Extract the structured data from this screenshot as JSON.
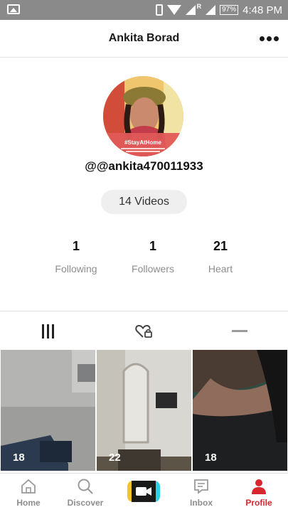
{
  "status_bar": {
    "time": "4:48 PM",
    "battery": "97%",
    "network_tag": "R"
  },
  "header": {
    "title": "Ankita Borad"
  },
  "profile": {
    "avatar_caption": "#StayAtHome",
    "username": "@@ankita470011933",
    "videos_label": "14 Videos",
    "stats": [
      {
        "value": "1",
        "label": "Following"
      },
      {
        "value": "1",
        "label": "Followers"
      },
      {
        "value": "21",
        "label": "Heart"
      }
    ]
  },
  "tabs": [
    {
      "icon": "grid-icon"
    },
    {
      "icon": "liked-heart-lock-icon"
    },
    {
      "icon": "dash-icon"
    }
  ],
  "videos": [
    {
      "count": "18"
    },
    {
      "count": "22"
    },
    {
      "count": "18"
    }
  ],
  "bottom_nav": {
    "items": [
      {
        "label": "Home",
        "icon": "home-icon"
      },
      {
        "label": "Discover",
        "icon": "search-icon"
      },
      {
        "label": "",
        "icon": "camera-icon"
      },
      {
        "label": "Inbox",
        "icon": "inbox-icon"
      },
      {
        "label": "Profile",
        "icon": "person-icon"
      }
    ],
    "active_color": "#d8262e"
  }
}
